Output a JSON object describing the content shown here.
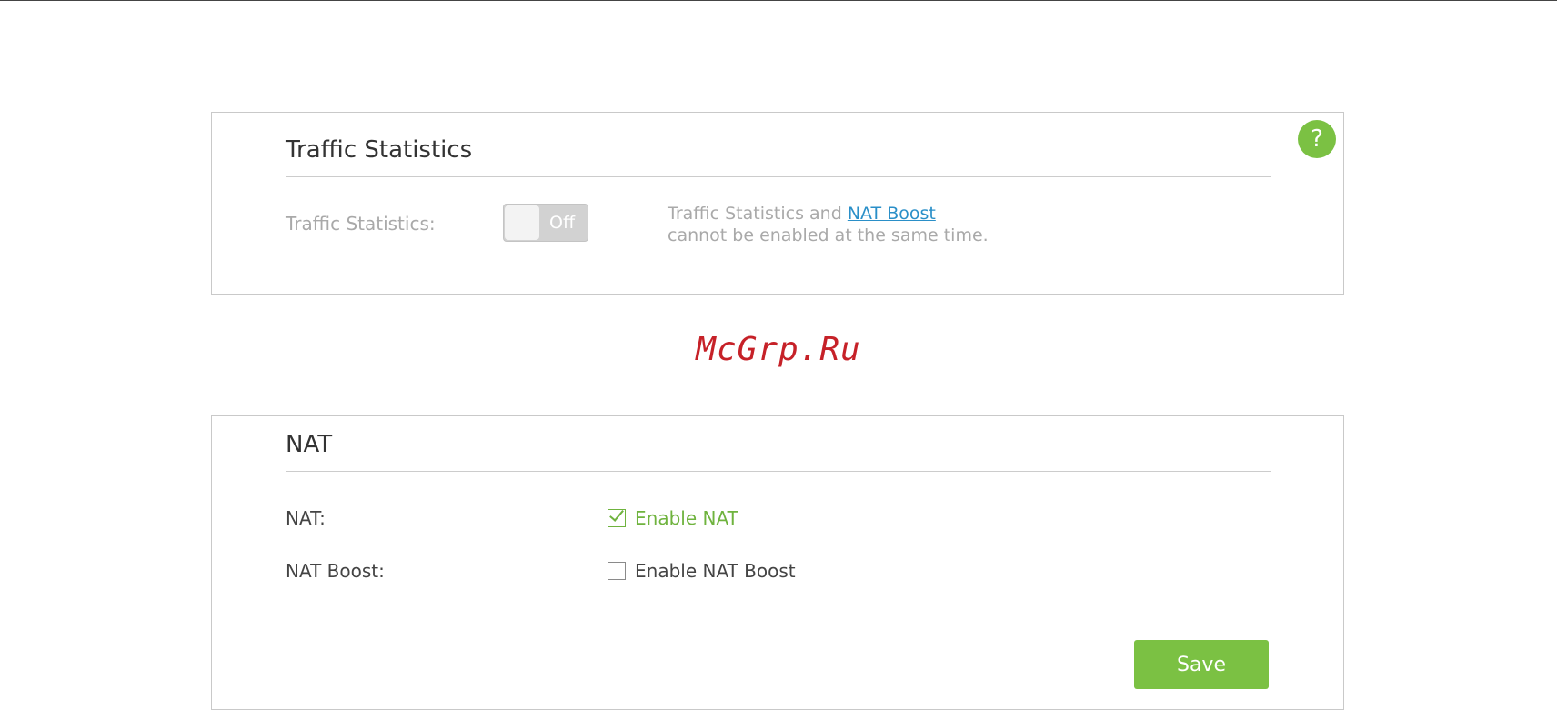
{
  "traffic_statistics": {
    "title": "Traffic Statistics",
    "label": "Traffic Statistics:",
    "toggle_state": "Off",
    "note_prefix": "Traffic Statistics and",
    "note_link": "NAT Boost",
    "note_suffix": "cannot be enabled at the same time."
  },
  "help": {
    "icon": "question-mark-icon",
    "glyph": "?"
  },
  "watermark": "McGrp.Ru",
  "nat": {
    "title": "NAT",
    "nat_label": "NAT:",
    "nat_checkbox_label": "Enable NAT",
    "nat_checked": true,
    "boost_label": "NAT Boost:",
    "boost_checkbox_label": "Enable NAT Boost",
    "boost_checked": false,
    "save_label": "Save"
  },
  "colors": {
    "accent_green": "#7bc143",
    "link_blue": "#2a8fc8",
    "watermark_red": "#c62128"
  }
}
